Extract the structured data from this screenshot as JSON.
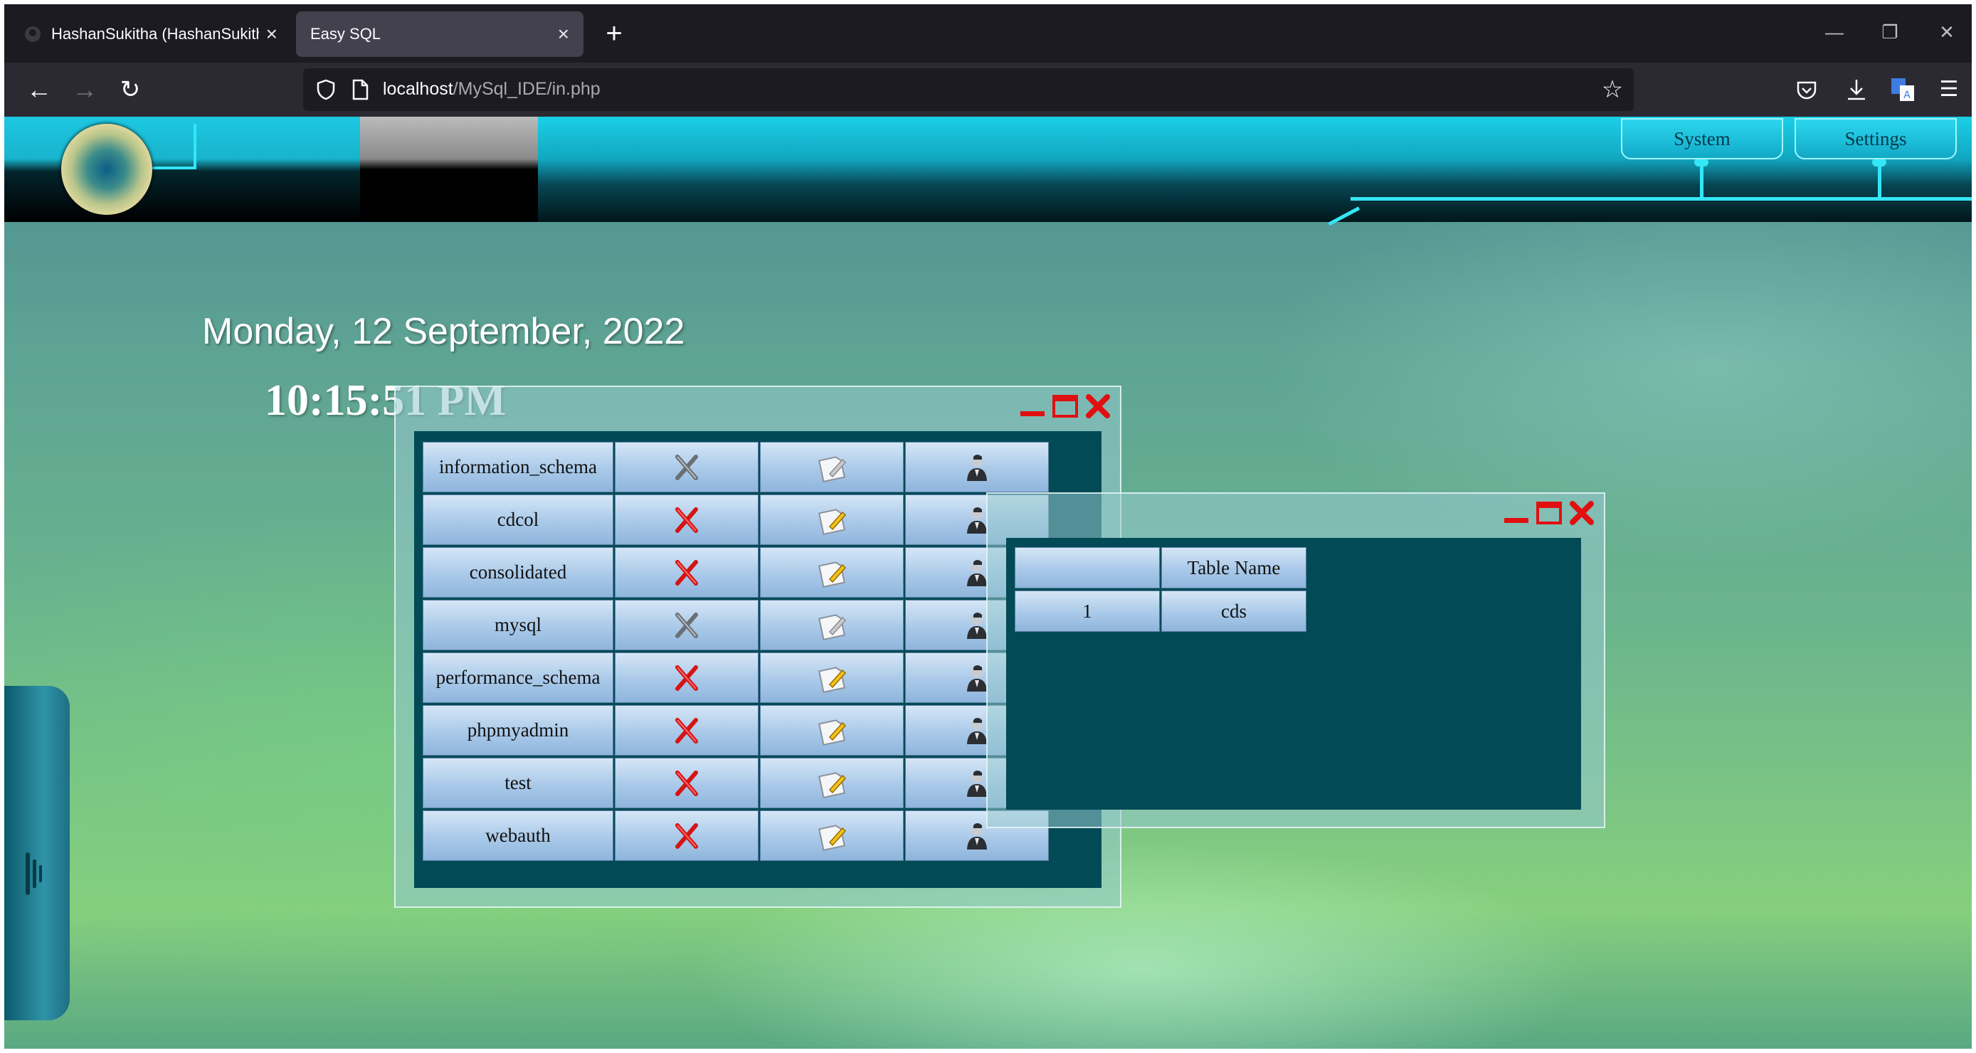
{
  "browser": {
    "tabs": [
      {
        "title": "HashanSukitha (HashanSukitha)",
        "active": false
      },
      {
        "title": "Easy SQL",
        "active": true
      }
    ],
    "new_tab_icon": "plus-icon",
    "url_host": "localhost",
    "url_path": "/MySql_IDE/in.php"
  },
  "header": {
    "nav": [
      "System",
      "Settings"
    ],
    "accent_color": "#34e6f6"
  },
  "clock": {
    "date": "Monday, 12 September, 2022",
    "time": "10:15:51 PM"
  },
  "databases_window": {
    "rows": [
      {
        "name": "information_schema",
        "delete_enabled": false
      },
      {
        "name": "cdcol",
        "delete_enabled": true
      },
      {
        "name": "consolidated",
        "delete_enabled": true
      },
      {
        "name": "mysql",
        "delete_enabled": false
      },
      {
        "name": "performance_schema",
        "delete_enabled": true
      },
      {
        "name": "phpmyadmin",
        "delete_enabled": true
      },
      {
        "name": "test",
        "delete_enabled": true
      },
      {
        "name": "webauth",
        "delete_enabled": true
      }
    ],
    "row_icons": [
      "delete-icon",
      "edit-icon",
      "user-icon"
    ],
    "controls": [
      "minimize-icon",
      "maximize-icon",
      "close-icon"
    ]
  },
  "tables_window": {
    "header": [
      "",
      "Table Name"
    ],
    "rows": [
      [
        "1",
        "cds"
      ]
    ],
    "controls": [
      "minimize-icon",
      "maximize-icon",
      "close-icon"
    ]
  },
  "colors": {
    "window_inner": "#024a56",
    "control_red": "#e01010"
  }
}
